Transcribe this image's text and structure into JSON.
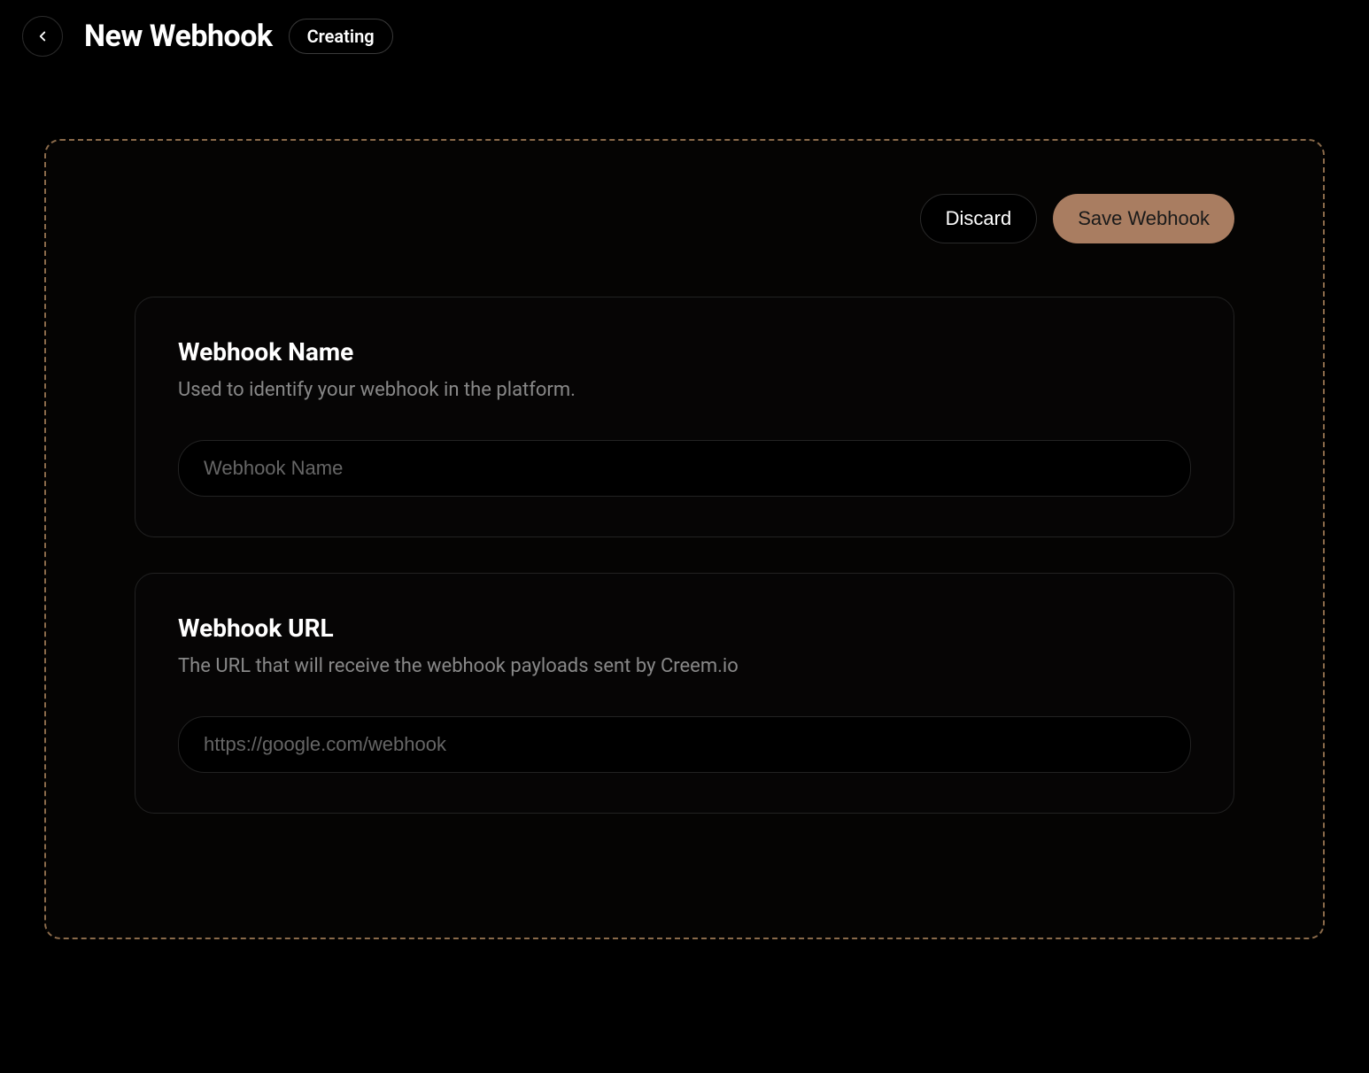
{
  "header": {
    "title": "New Webhook",
    "status_badge": "Creating"
  },
  "actions": {
    "discard_label": "Discard",
    "save_label": "Save Webhook"
  },
  "cards": {
    "name": {
      "title": "Webhook Name",
      "description": "Used to identify your webhook in the platform.",
      "placeholder": "Webhook Name",
      "value": ""
    },
    "url": {
      "title": "Webhook URL",
      "description": "The URL that will receive the webhook payloads sent by Creem.io",
      "placeholder": "https://google.com/webhook",
      "value": ""
    }
  }
}
